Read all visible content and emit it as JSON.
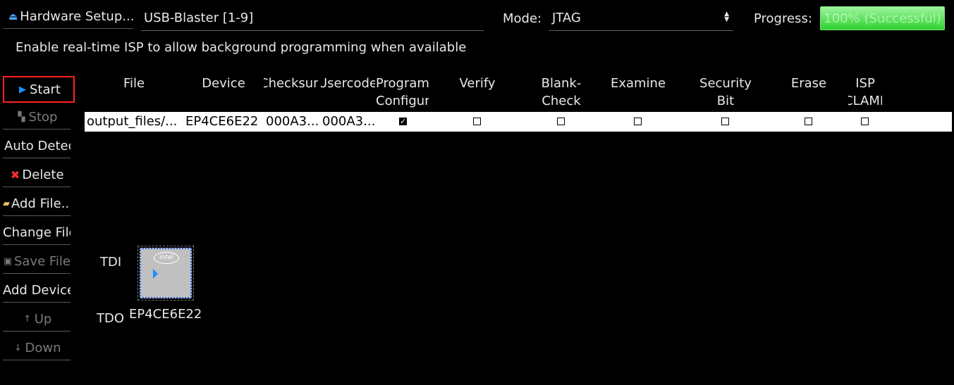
{
  "toolbar": {
    "hardware_setup_label": "Hardware Setup...",
    "hardware_value": "USB-Blaster [1-9]",
    "mode_label": "Mode:",
    "mode_value": "JTAG",
    "progress_label": "Progress:",
    "progress_text": "100% (Successful)",
    "progress_fraction": 1.0
  },
  "isp_option_label": "Enable real-time ISP to allow background programming when available",
  "sidebar": {
    "start": "Start",
    "stop": "Stop",
    "auto_detect": "Auto Detect",
    "delete": "Delete",
    "add_file": "Add File...",
    "change_file": "Change File",
    "save_file": "Save File",
    "add_device": "Add Device",
    "up": "Up",
    "down": "Down"
  },
  "table": {
    "headers": {
      "file": "File",
      "device": "Device",
      "checksum": "Checksum",
      "usercode": "Usercode",
      "program_l1": "Program",
      "program_l2": "Configure",
      "verify": "Verify",
      "blank_l1": "Blank-",
      "blank_l2": "Check",
      "examine": "Examine",
      "security_l1": "Security",
      "security_l2": "Bit",
      "erase": "Erase",
      "isp_l1": "ISP",
      "isp_l2": "CLAMP"
    },
    "row": {
      "file": "output_files/...",
      "device": "EP4CE6E22",
      "checksum": "000A3...",
      "usercode": "000A3...",
      "program": true,
      "verify": false,
      "blank_check": false,
      "examine": false,
      "security_bit": false,
      "erase": false,
      "isp_clamp": false
    }
  },
  "chain": {
    "tdi_label": "TDI",
    "tdo_label": "TDO",
    "device_name": "EP4CE6E22",
    "logo_text": "intel"
  },
  "colors": {
    "background": "#000000",
    "progress_green": "#2fd12f",
    "start_highlight": "#ff2020",
    "delete_icon": "#ff3030",
    "arrow_blue": "#1a8fff"
  }
}
